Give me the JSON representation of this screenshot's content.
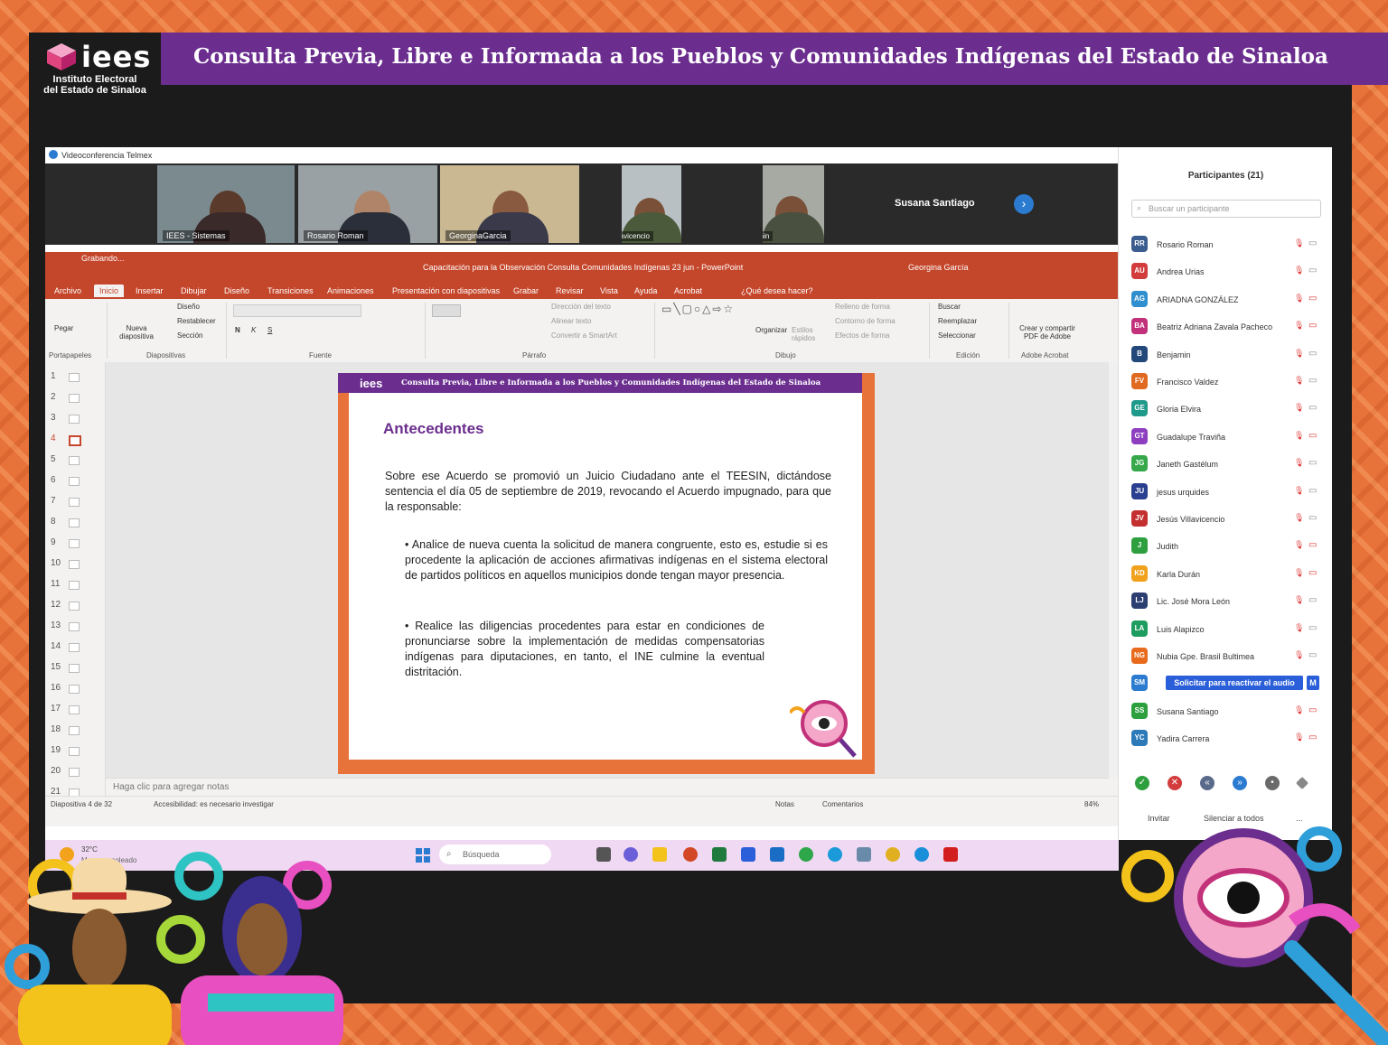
{
  "banner": {
    "logo_text": "iees",
    "logo_sub_1": "Instituto Electoral",
    "logo_sub_2": "del Estado de Sinaloa",
    "title": "Consulta Previa, Libre e Informada a los Pueblos y Comunidades Indígenas del Estado de Sinaloa"
  },
  "colors": {
    "purple": "#6b2e8f",
    "orange": "#e8733a",
    "ppt_red": "#c4462b",
    "blue": "#2b5fd9"
  },
  "window": {
    "title": "Videoconferencia Telmex",
    "controls": [
      "—",
      "▢",
      "✕"
    ]
  },
  "video_tiles": [
    {
      "name": "IEES - Sistemas"
    },
    {
      "name": "Rosario Roman"
    },
    {
      "name": "GeorginaGarcia"
    },
    {
      "name": "Jesús Villavicencio"
    },
    {
      "name": "Benjamin"
    }
  ],
  "active_speaker_name": "Susana Santiago",
  "powerpoint": {
    "recording": "Grabando...",
    "doc_title": "Capacitación para la Observación Consulta Comunidades Indígenas 23 jun  -  PowerPoint",
    "user": "Georgina García",
    "tabs": [
      "Archivo",
      "Inicio",
      "Insertar",
      "Dibujar",
      "Diseño",
      "Transiciones",
      "Animaciones",
      "Presentación con diapositivas",
      "Grabar",
      "Revisar",
      "Vista",
      "Ayuda",
      "Acrobat",
      "¿Qué desea hacer?"
    ],
    "ribbon_groups": [
      "Portapapeles",
      "Diapositivas",
      "Fuente",
      "Párrafo",
      "Dibujo",
      "Edición",
      "Adobe Acrobat"
    ],
    "ribbon_buttons": {
      "paste": "Pegar",
      "new_slide": "Nueva diapositiva",
      "layout": "Diseño",
      "reset": "Restablecer",
      "section": "Sección",
      "text_dir": "Dirección del texto",
      "align_text": "Alinear texto",
      "smartart": "Convertir a SmartArt",
      "arrange": "Organizar",
      "quick_styles": "Estilos rápidos",
      "shape_fill": "Relleno de forma",
      "shape_outline": "Contorno de forma",
      "shape_effects": "Efectos de forma",
      "find": "Buscar",
      "replace": "Reemplazar",
      "select": "Seleccionar",
      "adobe": "Crear y compartir PDF de Adobe"
    },
    "slide_numbers": [
      "1",
      "2",
      "3",
      "4",
      "5",
      "6",
      "7",
      "8",
      "9",
      "10",
      "11",
      "12",
      "13",
      "14",
      "15",
      "16",
      "17",
      "18",
      "19",
      "20",
      "21"
    ],
    "notes_placeholder": "Haga clic para agregar notas",
    "status": {
      "slide_count": "Diapositiva 4 de 32",
      "accessibility": "Accesibilidad: es necesario investigar",
      "notes": "Notas",
      "comments": "Comentarios",
      "zoom": "84%"
    }
  },
  "slide": {
    "logo": "iees",
    "header": "Consulta Previa, Libre e Informada a los Pueblos y Comunidades Indígenas del Estado de Sinaloa",
    "heading": "Antecedentes",
    "paragraph": "Sobre ese Acuerdo se promovió un Juicio Ciudadano ante el TEESIN, dictándose sentencia el día 05 de septiembre de 2019, revocando el Acuerdo impugnado, para que la responsable:",
    "bullet_1": "• Analice de nueva cuenta la solicitud de manera congruente, esto es, estudie si es procedente la aplicación de acciones afirmativas indígenas en el sistema electoral de partidos políticos en aquellos municipios donde tengan mayor presencia.",
    "bullet_2": "• Realice las diligencias procedentes para estar en condiciones de pronunciarse sobre la implementación de medidas compensatorias indígenas para diputaciones, en tanto, el INE culmine la eventual distritación."
  },
  "participants": {
    "title": "Participantes (21)",
    "search_placeholder": "Buscar un participante",
    "list": [
      {
        "initials": "RR",
        "name": "Rosario Roman",
        "color": "#3b5c8f",
        "cam_off": false
      },
      {
        "initials": "AU",
        "name": "Andrea Urias",
        "color": "#d23c3c",
        "cam_off": false
      },
      {
        "initials": "AG",
        "name": "ARIADNA GONZÁLEZ",
        "color": "#2f8fcf",
        "cam_off": true
      },
      {
        "initials": "BA",
        "name": "Beatriz Adriana Zavala Pacheco",
        "color": "#c2327a",
        "cam_off": true
      },
      {
        "initials": "B",
        "name": "Benjamin",
        "color": "#23497a",
        "cam_off": false
      },
      {
        "initials": "FV",
        "name": "Francisco Valdez",
        "color": "#e06a1f",
        "cam_off": false
      },
      {
        "initials": "GE",
        "name": "Gloria Elvira",
        "color": "#1f9a8a",
        "cam_off": false
      },
      {
        "initials": "GT",
        "name": "Guadalupe Traviña",
        "color": "#8e3fbf",
        "cam_off": true
      },
      {
        "initials": "JG",
        "name": "Janeth Gastélum",
        "color": "#36a84a",
        "cam_off": false
      },
      {
        "initials": "JU",
        "name": "jesus urquides",
        "color": "#2a3f8f",
        "cam_off": false
      },
      {
        "initials": "JV",
        "name": "Jesús Villavicencio",
        "color": "#c43030",
        "cam_off": false
      },
      {
        "initials": "J",
        "name": "Judith",
        "color": "#2e9f3e",
        "cam_off": true
      },
      {
        "initials": "KD",
        "name": "Karla Durán",
        "color": "#f0a21c",
        "cam_off": true
      },
      {
        "initials": "LJ",
        "name": "Lic. José Mora León",
        "color": "#2c3f70",
        "cam_off": false
      },
      {
        "initials": "LA",
        "name": "Luis Alapizco",
        "color": "#1f9c5f",
        "cam_off": false
      },
      {
        "initials": "NG",
        "name": "Nubia Gpe. Brasil Bultimea",
        "color": "#e86a1c",
        "cam_off": false
      }
    ],
    "reactivate_label": "Solicitar para reactivar el audio",
    "reactivate_more": "M",
    "reactivate_initials": "SM",
    "reactivate_color": "#2b7bd1",
    "after": [
      {
        "initials": "SS",
        "name": "Susana Santiago",
        "color": "#2e9f3e",
        "cam_off": true
      },
      {
        "initials": "YC",
        "name": "Yadira Carrera",
        "color": "#2c7ab8",
        "cam_off": true
      }
    ],
    "invite": "Invitar",
    "mute_all": "Silenciar a todos",
    "more": "..."
  },
  "taskbar": {
    "temp": "32°C",
    "weather": "Mayorm. soleado",
    "search": "Búsqueda"
  }
}
